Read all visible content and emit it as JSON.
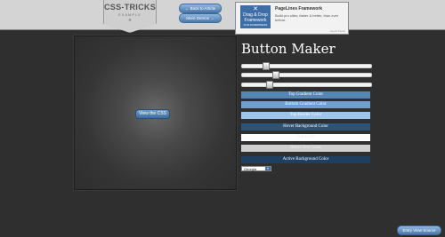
{
  "header": {
    "logo_text": "CSS-TRICKS",
    "logo_subtext": "EXAMPLE",
    "logo_star": "★",
    "back_button": "← Back to Article",
    "more_demos_button": "More Demos →"
  },
  "ad": {
    "image_symbol": "✕",
    "image_line1": "Drag & Drop",
    "image_line2": "Framework",
    "image_line3": "FOR WORDPRESS",
    "title": "PageLines Framework",
    "description": "Build pro sites; faster & better, than ever before.",
    "via": "via Ad Packs"
  },
  "preview": {
    "button_label": "View the CSS"
  },
  "maker": {
    "title": "Button Maker",
    "sliders": [
      {
        "name": "slider-1",
        "value": 0.17
      },
      {
        "name": "slider-2",
        "value": 0.25
      },
      {
        "name": "slider-3",
        "value": 0.2
      }
    ],
    "color_bars": [
      {
        "label": "Top Gradient Color",
        "bg": "#5686b3",
        "text_color": "#ffffff"
      },
      {
        "label": "Bottom Gradient Color",
        "bg": "#6e9fd1",
        "text_color": "#ffffff"
      },
      {
        "label": "Top Border Color",
        "bg": "#9fc6ea",
        "text_color": "#ffffff"
      },
      {
        "label": "Hover Background Color",
        "bg": "#2c5378",
        "text_color": "#ffffff"
      },
      {
        "label": "Text Color",
        "bg": "#ffffff",
        "text_color": "#e8e8e8"
      },
      {
        "label": "Hover Text Color",
        "bg": "#cfcfcf",
        "text_color": "#f0f0f0"
      },
      {
        "label": "Active Background Color",
        "bg": "#1e3f60",
        "text_color": "#ffffff"
      }
    ],
    "font_select": "Georgia"
  },
  "footer": {
    "source_button": "Entry View Source"
  }
}
